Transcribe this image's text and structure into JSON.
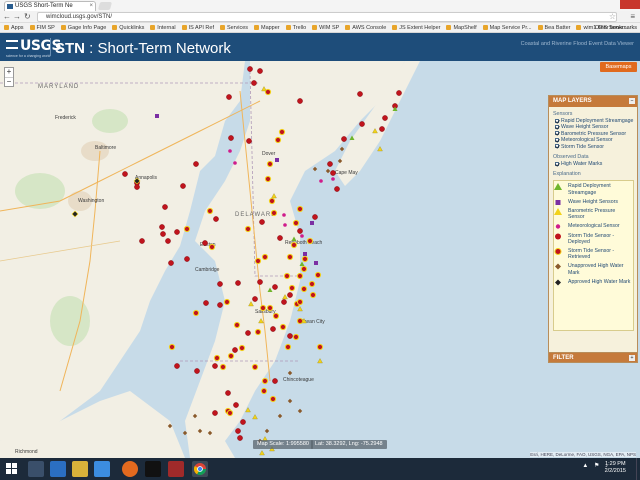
{
  "browser": {
    "tab_title": "USGS Short-Term Ne",
    "url": "wimcloud.usgs.gov/STN/",
    "bookmarks": [
      "Apps",
      "FIM SP",
      "Gage Info Page",
      "Quicklinks",
      "Internal",
      "IS API Ref",
      "Services",
      "Mapper",
      "Trello",
      "WIM SP",
      "AWS Console",
      "JS Extent Helper",
      "MapShelf",
      "Map Service Pr...",
      "Bea Batter",
      "wim1 GIS Serve..."
    ],
    "other_bookmarks": "Other bookmarks"
  },
  "header": {
    "logo": "USGS",
    "tagline": "science for a changing world",
    "app_short": "STN",
    "app_name": "Short-Term Network",
    "right_link": "Coastal and Riverine Flood Event Data Viewer"
  },
  "map": {
    "basemaps_label": "Basemaps",
    "zoom_in": "+",
    "zoom_out": "−",
    "scale_text": "Map Scale: 1:995580",
    "coords_text": "Lat: 38.3292, Lng: -75.2948",
    "attribution": "Esri, HERE, DeLorme, FAO, USGS, NGA, EPA, NPS",
    "labels": [
      {
        "t": "MARYLAND"
      },
      {
        "t": "Baltimore"
      },
      {
        "t": "Washington"
      },
      {
        "t": "Annapolis"
      },
      {
        "t": "Dover"
      },
      {
        "t": "DELAWARE"
      },
      {
        "t": "Salisbury"
      },
      {
        "t": "Ocean City"
      },
      {
        "t": "Cape May"
      },
      {
        "t": "Richmond"
      },
      {
        "t": "Rehoboth Beach"
      },
      {
        "t": "Chincoteague"
      },
      {
        "t": "Frederick"
      },
      {
        "t": "Cambridge"
      },
      {
        "t": "Easton"
      }
    ]
  },
  "panel": {
    "title": "MAP LAYERS",
    "sensors_heading": "Sensors",
    "sensors": [
      "Rapid Deployment Streamgage",
      "Wave Height Sensor",
      "Barometric Pressure Sensor",
      "Meteorological Sensor",
      "Storm Tide Sensor"
    ],
    "observed_heading": "Observed Data",
    "observed": [
      "High Water Marks"
    ],
    "explanation_heading": "Explanation",
    "legend": [
      {
        "label": "Rapid Deployment Streamgage",
        "symbol": "green-triangle",
        "color": "#6fb52c"
      },
      {
        "label": "Wave Height Sensors",
        "symbol": "purple-square",
        "color": "#7b2fa3"
      },
      {
        "label": "Barometric Pressure Sensor",
        "symbol": "yellow-triangle",
        "color": "#f2d21b"
      },
      {
        "label": "Meteorological Sensor",
        "symbol": "magenta-dot",
        "color": "#d01c8b"
      },
      {
        "label": "Storm Tide Sensor - Deployed",
        "symbol": "red-dot",
        "color": "#c0141d"
      },
      {
        "label": "Storm Tide Sensor - Retrieved",
        "symbol": "red-dot-yellow-ring",
        "color": "#c0141d"
      },
      {
        "label": "Unapproved High Water Mark",
        "symbol": "brown-diamond",
        "color": "#8a5a2b"
      },
      {
        "label": "Approved High Water Mark",
        "symbol": "black-diamond",
        "color": "#222222"
      }
    ],
    "filter_title": "FILTER"
  },
  "taskbar": {
    "time": "1:29 PM",
    "date": "2/2/2015"
  },
  "colors": {
    "header_bg": "#1e4d7a",
    "panel_header": "#c57a3b",
    "basemaps_btn": "#e06a1e",
    "water": "#c7dbe8",
    "land": "#f2efe4"
  }
}
